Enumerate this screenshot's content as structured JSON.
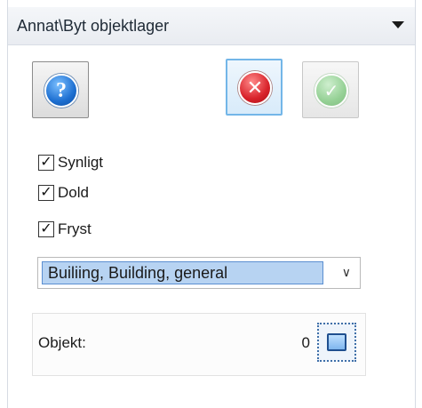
{
  "header": {
    "title": "Annat\\Byt objektlager",
    "collapse_icon": "chevron-down-icon"
  },
  "toolbar": {
    "help_icon": "question-icon",
    "help_glyph": "?",
    "cancel_icon": "cancel-x-icon",
    "cancel_glyph": "✕",
    "ok_icon": "checkmark-icon",
    "ok_glyph": "✓",
    "colors": {
      "help": "#1d6fd1",
      "cancel": "#d8222a",
      "ok": "#86cc86"
    }
  },
  "checkboxes": [
    {
      "label": "Synligt",
      "checked": true,
      "mark": "✓"
    },
    {
      "label": "Dold",
      "checked": true,
      "mark": "✓"
    },
    {
      "label": "Fryst",
      "checked": true,
      "mark": "✓"
    }
  ],
  "layer_select": {
    "value": "Builiing, Building, general",
    "arrow": "∨"
  },
  "object": {
    "label": "Objekt:",
    "count": "0",
    "select_icon": "select-objects-icon"
  }
}
